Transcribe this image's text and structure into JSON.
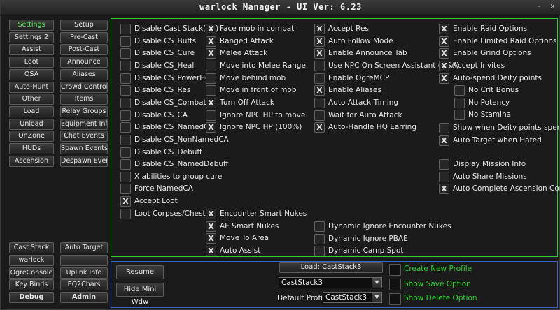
{
  "window": {
    "title": "warlock Manager   - UI Ver: 6.23",
    "minimize": "-",
    "close": "×"
  },
  "nav": {
    "col1": [
      "Settings",
      "Settings 2",
      "Assist",
      "Loot",
      "OSA",
      "Auto-Hunt",
      "Other",
      "Load",
      "Unload",
      "OnZone",
      "HUDs",
      "Ascension"
    ],
    "col2": [
      "Setup",
      "Pre-Cast",
      "Post-Cast",
      "Announce",
      "Aliases",
      "Crowd Control",
      "Items",
      "Relay Groups",
      "Equipment Info",
      "Chat Events",
      "Spawn Events",
      "Despawn Events"
    ],
    "bottom_col1": [
      "Cast Stack",
      "warlock",
      "OgreConsole",
      "Key Binds",
      "Debug"
    ],
    "bottom_col2": [
      "Auto Target",
      "",
      "Uplink Info",
      "EQ2Chars",
      "Admin"
    ]
  },
  "options": {
    "col1": [
      {
        "label": "Disable Cast Stack(CS)",
        "checked": false
      },
      {
        "label": "Disable CS_Buffs",
        "checked": false
      },
      {
        "label": "Disable CS_Cure",
        "checked": false
      },
      {
        "label": "Disable CS_Heal",
        "checked": false
      },
      {
        "label": "Disable CS_PowerHeal",
        "checked": false
      },
      {
        "label": "Disable CS_Res",
        "checked": false
      },
      {
        "label": "Disable CS_Combat",
        "checked": false
      },
      {
        "label": "Disable CS_CA",
        "checked": false
      },
      {
        "label": "Disable CS_NamedCA",
        "checked": false
      },
      {
        "label": "Disable CS_NonNamedCA",
        "checked": false
      },
      {
        "label": "Disable CS_Debuff",
        "checked": false
      },
      {
        "label": "Disable CS_NamedDebuff",
        "checked": false
      },
      {
        "label": "X abilities to group cure",
        "checked": false
      },
      {
        "label": "Force NamedCA",
        "checked": false
      },
      {
        "label": "Accept Loot",
        "checked": true
      },
      {
        "label": "Loot Corpses/Chests",
        "checked": false
      }
    ],
    "col2": [
      {
        "label": "Face mob in combat",
        "checked": true
      },
      {
        "label": "Ranged Attack",
        "checked": true
      },
      {
        "label": "Melee Attack",
        "checked": true
      },
      {
        "label": "Move into Melee Range",
        "checked": false
      },
      {
        "label": "Move behind mob",
        "checked": false
      },
      {
        "label": "Move in front of mob",
        "checked": false
      },
      {
        "label": "Turn Off Attack",
        "checked": true
      },
      {
        "label": "Ignore NPC HP to move",
        "checked": false
      },
      {
        "label": "Ignore NPC HP (100%)",
        "checked": true
      }
    ],
    "col2b": [
      {
        "label": "Encounter Smart Nukes",
        "checked": true
      },
      {
        "label": "AE Smart Nukes",
        "checked": true
      },
      {
        "label": "Move To Area",
        "checked": true
      },
      {
        "label": "Auto Assist",
        "checked": true
      }
    ],
    "col3": [
      {
        "label": "Accept Res",
        "checked": true
      },
      {
        "label": "Auto Follow Mode",
        "checked": true
      },
      {
        "label": "Enable Announce Tab",
        "checked": true
      },
      {
        "label": "Use NPC On Screen Assistant (OSA)",
        "checked": false
      },
      {
        "label": "Enable OgreMCP",
        "checked": false
      },
      {
        "label": "Enable Aliases",
        "checked": true
      },
      {
        "label": "Auto Attack Timing",
        "checked": false
      },
      {
        "label": "Wait for Auto Attack",
        "checked": false
      },
      {
        "label": "Auto-Handle HQ Earring",
        "checked": true
      }
    ],
    "col3b": [
      {
        "label": "Dynamic Ignore Encounter Nukes",
        "checked": false
      },
      {
        "label": "Dynamic Ignore PBAE",
        "checked": false
      },
      {
        "label": "Dynamic Camp Spot",
        "checked": false
      }
    ],
    "col4": [
      {
        "label": "Enable Raid Options",
        "checked": true
      },
      {
        "label": "Enable Limited Raid Options",
        "checked": true
      },
      {
        "label": "Enable Grind Options",
        "checked": true
      },
      {
        "label": "Accept Invites",
        "checked": true
      },
      {
        "label": "Auto-spend Deity points",
        "checked": true
      }
    ],
    "col4sub": [
      {
        "label": "No Crit Bonus",
        "checked": false
      },
      {
        "label": "No Potency",
        "checked": false
      },
      {
        "label": "No Stamina",
        "checked": false
      }
    ],
    "col4b": [
      {
        "label": "Show when Deity points spent",
        "checked": false
      },
      {
        "label": "Auto Target when Hated",
        "checked": true
      }
    ],
    "col4c": [
      {
        "label": "Display Mission Info",
        "checked": false
      },
      {
        "label": "Auto Share Missions",
        "checked": false
      },
      {
        "label": "Auto Complete Ascension Combos",
        "checked": true
      }
    ]
  },
  "profile": {
    "resume": "Resume",
    "hide_mini": "Hide Mini Wdw",
    "load_button": "Load: CastStack3",
    "profile_combo": "CastStack3",
    "default_label": "Default Profile:",
    "default_combo": "CastStack3",
    "create_new": "Create New Profile",
    "show_save": "Show Save Option",
    "show_delete": "Show Delete Option"
  },
  "colors": {
    "accent_green": "#2fd12f",
    "panel_blue": "#3a64c8"
  }
}
